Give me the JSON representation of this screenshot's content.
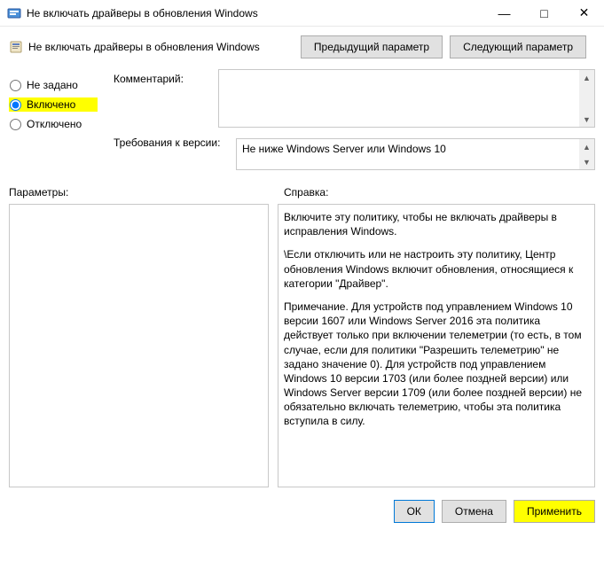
{
  "window": {
    "title": "Не включать драйверы в обновления Windows"
  },
  "subheader": {
    "title": "Не включать драйверы в обновления Windows"
  },
  "nav": {
    "prev": "Предыдущий параметр",
    "next": "Следующий параметр"
  },
  "radios": {
    "not_configured": "Не задано",
    "enabled": "Включено",
    "disabled": "Отключено",
    "selected": "enabled"
  },
  "labels": {
    "comment": "Комментарий:",
    "requirements": "Требования к версии:",
    "parameters": "Параметры:",
    "help": "Справка:"
  },
  "fields": {
    "comment": "",
    "requirements": "Не ниже Windows Server или Windows 10"
  },
  "help": {
    "p1": "Включите эту политику, чтобы не включать драйверы в исправления Windows.",
    "p2": "\\Если отключить или не настроить эту политику, Центр обновления Windows включит обновления, относящиеся к категории \"Драйвер\".",
    "p3": "Примечание. Для устройств под управлением Windows 10 версии 1607 или Windows Server 2016 эта политика действует только при включении телеметрии (то есть, в том случае, если для политики \"Разрешить телеметрию\" не задано значение 0). Для устройств под управлением Windows 10 версии 1703 (или более поздней версии) или Windows Server версии 1709 (или более поздней версии) не обязательно включать телеметрию, чтобы эта политика вступила в силу."
  },
  "footer": {
    "ok": "ОК",
    "cancel": "Отмена",
    "apply": "Применить"
  }
}
